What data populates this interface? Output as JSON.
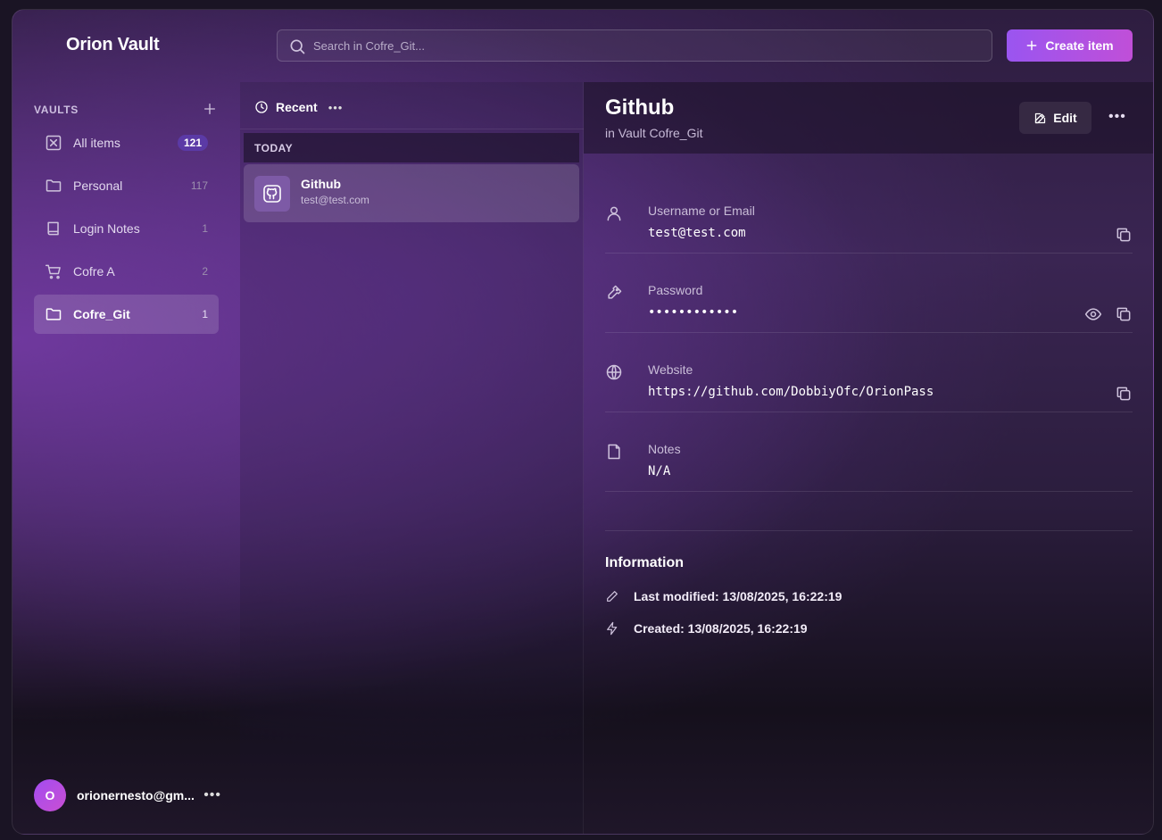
{
  "app": {
    "brand": "Orion Vault"
  },
  "search": {
    "placeholder": "Search in Cofre_Git..."
  },
  "header": {
    "create_label": "Create item"
  },
  "sidebar": {
    "section_title": "VAULTS",
    "vaults": [
      {
        "label": "All items",
        "count": "121",
        "icon": "x-box-icon"
      },
      {
        "label": "Personal",
        "count": "117",
        "icon": "folder-icon"
      },
      {
        "label": "Login Notes",
        "count": "1",
        "icon": "book-icon"
      },
      {
        "label": "Cofre A",
        "count": "2",
        "icon": "cart-icon"
      },
      {
        "label": "Cofre_Git",
        "count": "1",
        "icon": "folder-icon"
      }
    ],
    "user": {
      "initial": "O",
      "email": "orionernesto@gm..."
    }
  },
  "list": {
    "heading": "Recent",
    "group": "TODAY",
    "items": [
      {
        "title": "Github",
        "subtitle": "test@test.com",
        "icon": "github-icon"
      }
    ]
  },
  "detail": {
    "title": "Github",
    "subtitle": "in Vault Cofre_Git",
    "edit_label": "Edit",
    "fields": {
      "username": {
        "label": "Username or Email",
        "value": "test@test.com"
      },
      "password": {
        "label": "Password",
        "value": "••••••••••••"
      },
      "website": {
        "label": "Website",
        "value": "https://github.com/DobbiyOfc/OrionPass"
      },
      "notes": {
        "label": "Notes",
        "value": "N/A"
      }
    },
    "info": {
      "title": "Information",
      "last_modified": "Last modified: 13/08/2025, 16:22:19",
      "created": "Created: 13/08/2025, 16:22:19"
    }
  },
  "colors": {
    "accent_start": "#9a55f0",
    "accent_end": "#c04fd8",
    "badge": "#5b3aa6"
  }
}
